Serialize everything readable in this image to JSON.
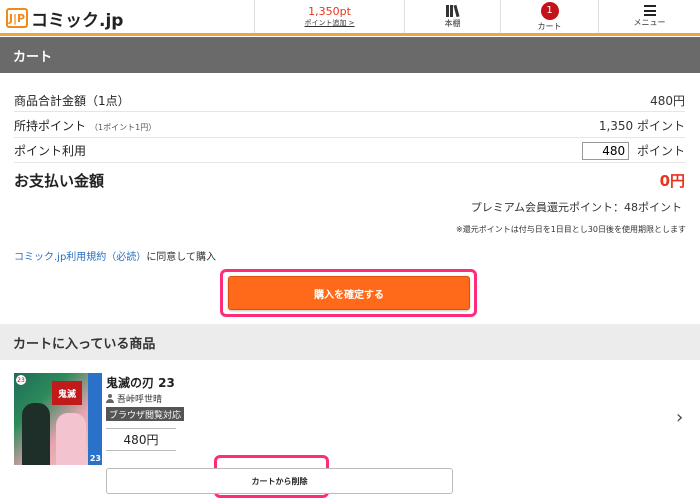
{
  "header": {
    "logo_mark": "J|P",
    "logo_text": "コミック.jp",
    "points_value": "1,350pt",
    "points_add": "ポイント追加 >",
    "shelf_label": "本棚",
    "cart_count": "1",
    "cart_label": "カート",
    "menu_label": "メニュー"
  },
  "cart_section": {
    "title": "カート",
    "subtotal_label": "商品合計金額（1点）",
    "subtotal_value": "480円",
    "owned_points_label": "所持ポイント",
    "owned_points_note": "（1ポイント1円）",
    "owned_points_value": "1,350 ポイント",
    "use_points_label": "ポイント利用",
    "use_points_input": "480",
    "use_points_unit": "ポイント",
    "total_label": "お支払い金額",
    "total_value": "0円",
    "premium_note": "プレミアム会員還元ポイント：48ポイント",
    "expiry_note": "※還元ポイントは付与日を1日目とし30日後を使用期限とします",
    "terms_link": "コミック.jp利用規約（必読）",
    "terms_text": "に同意して購入",
    "buy_button": "購入を確定する"
  },
  "items_section": {
    "title": "カートに入っている商品",
    "items": [
      {
        "title": "鬼滅の刃 23",
        "author": "吾峠呼世晴",
        "badge": "ブラウザ閲覧対応",
        "price": "480円",
        "cover_title": "鬼滅",
        "cover_volume": "23",
        "remove_button": "カートから削除"
      }
    ]
  },
  "colors": {
    "accent_orange": "#ff6a1a",
    "price_red": "#e8341c",
    "highlight_pink": "#ff2c7a",
    "section_gray": "#6a6a6a"
  }
}
